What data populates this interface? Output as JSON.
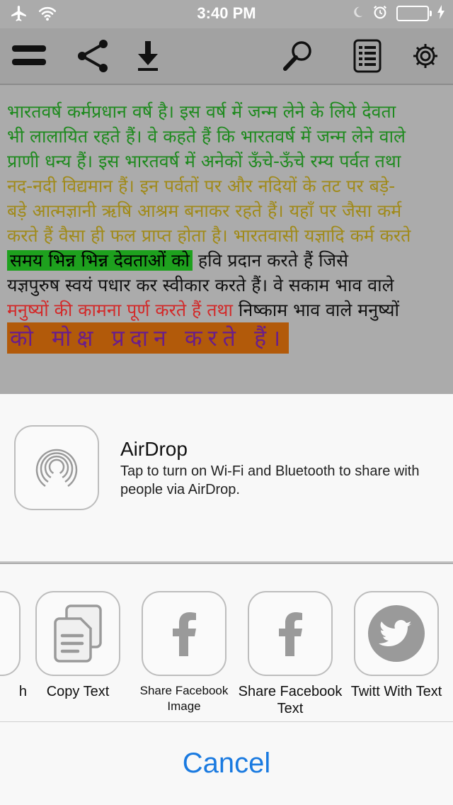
{
  "status_bar": {
    "time": "3:40 PM"
  },
  "toolbar": {
    "icons": [
      "menu-icon",
      "share-icon",
      "download-icon",
      "search-icon",
      "list-icon",
      "gear-icon"
    ]
  },
  "content": {
    "lines": [
      "भारतवर्ष कर्मप्रधान वर्ष है। इस वर्ष में जन्म लेने के लिये देवता",
      "भी लालायित रहते हैं। वे कहते हैं कि भारतवर्ष में जन्म लेने वाले",
      "प्राणी धन्य हैं। इस भारतवर्ष में अनेकों ऊँचे-ऊँचे रम्य पर्वत तथा",
      "नद-नदी विद्यमान हैं। इन पर्वतों पर और नदियों के तट पर बड़े-",
      "बड़े आत्मज्ञानी ऋषि आश्रम बनाकर रहते हैं। यहाँ पर जैसा कर्म",
      "करते हैं वैसा ही फल प्राप्त होता है। भारतवासी यज्ञादि कर्म करते"
    ],
    "line7_highlight": "समय भिन्न भिन्न देवताओं को",
    "line7_rest": "हवि प्रदान करते हैं जिसे",
    "line8": "यज्ञपुरुष स्वयं पधार कर स्वीकार करते हैं। वे सकाम भाव वाले",
    "line9_red": "मनुष्यों की कामना पूर्ण करते हैं तथा",
    "line9_black": "निष्काम भाव वाले मनुष्यों",
    "line10_highlight": "को मोक्ष प्रदान करते हैं।"
  },
  "share_sheet": {
    "airdrop": {
      "title": "AirDrop",
      "description": "Tap to turn on Wi-Fi and Bluetooth to share with people via AirDrop."
    },
    "actions": [
      {
        "label": "h",
        "icon": "partial-icon"
      },
      {
        "label": "Copy Text",
        "icon": "copy-icon"
      },
      {
        "label": "Share Facebook Image",
        "icon": "facebook-icon"
      },
      {
        "label": "Share Facebook Text",
        "icon": "facebook-icon"
      },
      {
        "label": "Twitt With Text",
        "icon": "twitter-icon"
      }
    ],
    "cancel_label": "Cancel"
  },
  "colors": {
    "accent": "#1a7ae0",
    "battery": "#4cd964",
    "text_green": "#1f8a1f",
    "text_olive": "#a08a1a",
    "text_red": "#d22a2a",
    "highlight_green": "#1ea11e",
    "highlight_orange": "#b25a0a"
  }
}
